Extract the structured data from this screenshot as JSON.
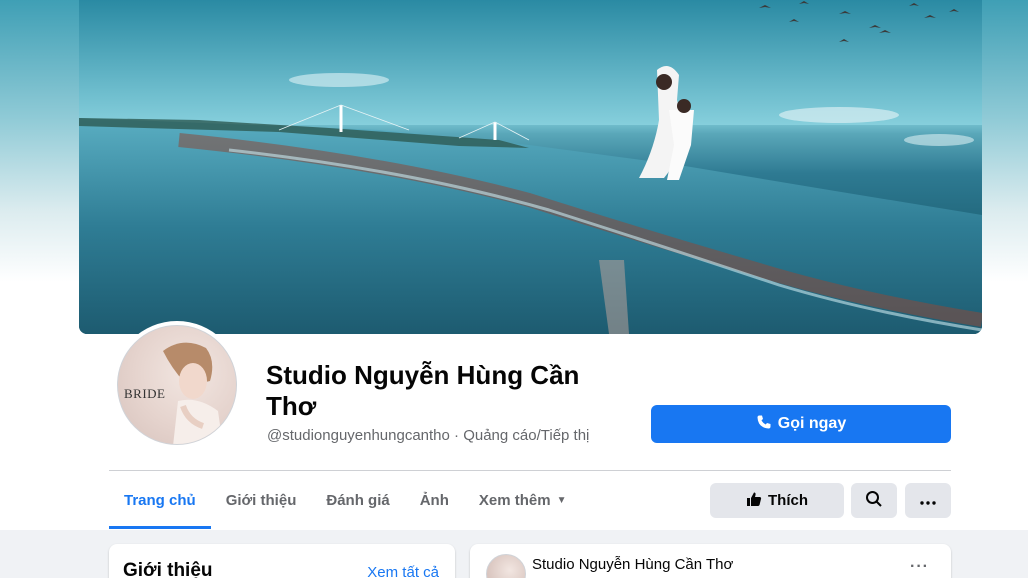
{
  "page": {
    "title": "Studio Nguyễn Hùng Cần Thơ",
    "handle_category": "@studionguyenhungcantho · Quảng cáo/Tiếp thị",
    "avatar_text": "BRIDE"
  },
  "actions": {
    "call_label": "Gọi ngay",
    "like_label": "Thích"
  },
  "tabs": [
    {
      "label": "Trang chủ"
    },
    {
      "label": "Giới thiệu"
    },
    {
      "label": "Đánh giá"
    },
    {
      "label": "Ảnh"
    },
    {
      "label": "Xem thêm"
    }
  ],
  "intro_card": {
    "title": "Giới thiệu",
    "see_all": "Xem tất cả"
  },
  "post_card": {
    "author": "Studio Nguyễn Hùng Cần Thơ",
    "more": "···"
  },
  "icons": {
    "call": "phone-icon",
    "like": "thumbs-up-icon",
    "search": "search-icon",
    "more": "more-horizontal-icon",
    "caret": "caret-down-icon"
  },
  "colors": {
    "accent": "#1877f2",
    "button_gray": "#e4e6eb",
    "text_primary": "#050505",
    "text_secondary": "#65676b"
  }
}
